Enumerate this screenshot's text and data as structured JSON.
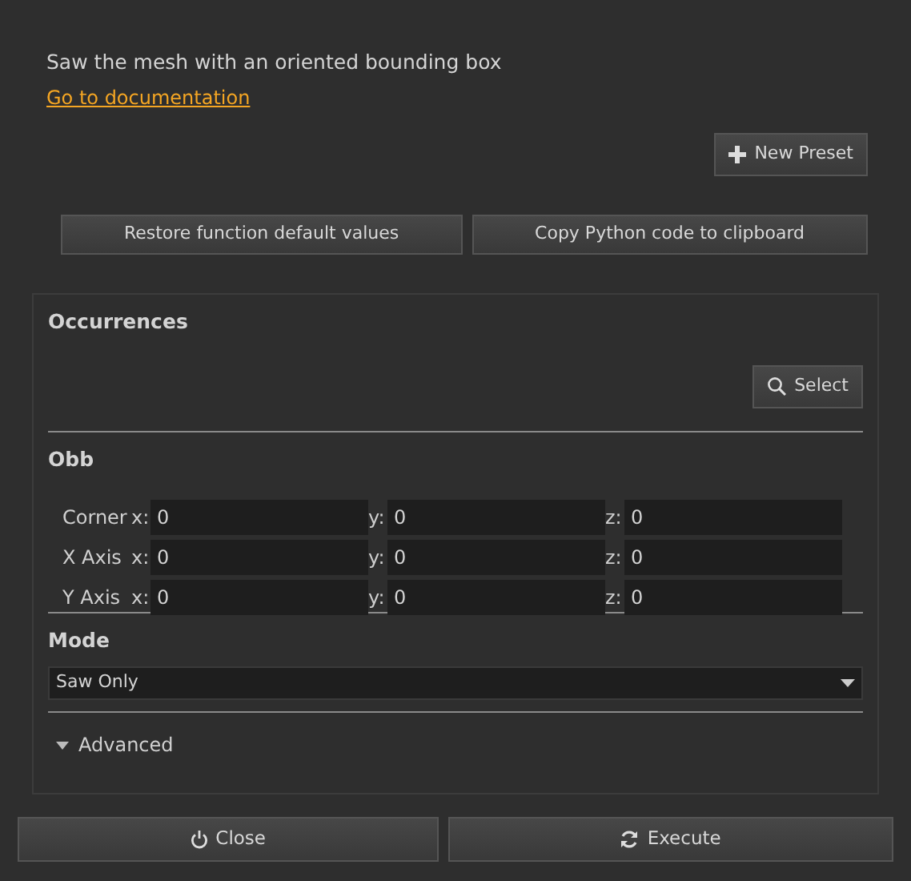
{
  "description": "Saw the mesh with an oriented bounding box",
  "doc_link": "Go to documentation",
  "new_preset_button": "New Preset",
  "top_buttons": [
    "Restore function default values",
    "Copy Python code to clipboard"
  ],
  "sections": {
    "occurrences": {
      "title": "Occurrences",
      "select_button": "Select"
    },
    "obb": {
      "title": "Obb",
      "rows": [
        {
          "label": "Corner",
          "fields": [
            {
              "axis": "x:",
              "value": "0"
            },
            {
              "axis": "y:",
              "value": "0"
            },
            {
              "axis": "z:",
              "value": "0"
            }
          ]
        },
        {
          "label": "X Axis",
          "fields": [
            {
              "axis": "x:",
              "value": "0"
            },
            {
              "axis": "y:",
              "value": "0"
            },
            {
              "axis": "z:",
              "value": "0"
            }
          ]
        },
        {
          "label": "Y Axis",
          "fields": [
            {
              "axis": "x:",
              "value": "0"
            },
            {
              "axis": "y:",
              "value": "0"
            },
            {
              "axis": "z:",
              "value": "0"
            }
          ]
        }
      ]
    },
    "mode": {
      "title": "Mode",
      "value": "Saw Only"
    },
    "advanced": {
      "label": "Advanced",
      "expanded": false
    }
  },
  "bottom_buttons": [
    {
      "kind": "close",
      "label": "Close"
    },
    {
      "kind": "execute",
      "label": "Execute"
    }
  ]
}
